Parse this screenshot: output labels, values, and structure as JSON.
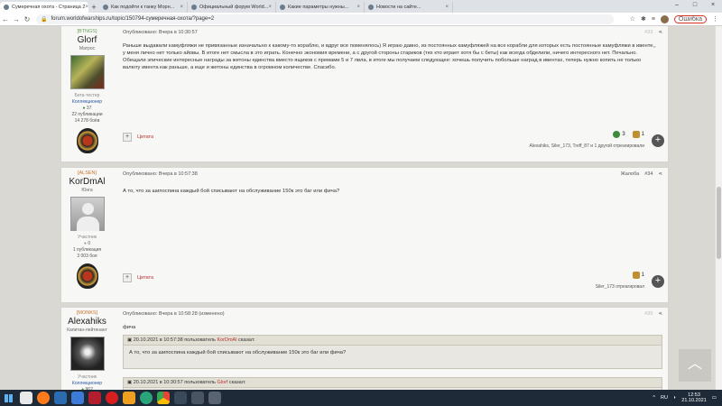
{
  "browser": {
    "tabs": [
      {
        "label": "Сумеречная охота - Страница 2",
        "active": true
      },
      {
        "label": "Как подойти к танку Морн...",
        "active": false
      },
      {
        "label": "Официальный форум World...",
        "active": false
      },
      {
        "label": "Какие параметры нужны...",
        "active": false
      },
      {
        "label": "Новости на сайте...",
        "active": false
      }
    ],
    "url": "forum.worldofwarships.ru/topic/150794-сумеречная-охота/?page=2",
    "error_label": "Ошибка"
  },
  "posts": [
    {
      "clan": "[BTNGS]",
      "username": "Glorf",
      "rank": "Матрос",
      "meta": [
        "Бета-тестер",
        "Коллекционер",
        "37",
        "22 публикации",
        "14 278 боёв"
      ],
      "published": "Опубликовано: Вчера в 10:30:57",
      "number": "#33",
      "text": "Раньше выдавали камуфляжи не привязанные изначально к какому-то кораблю, и вдруг все поменялось) Я играю давно, из постоянных камуфляжей на все корабли для которых есть постоянные камуфляжи в ивенте,, у меня лично нет только айовы. В итоге нет смысла в это играть. Конечно экономия времени, а с другой стороны стариков (тех кто играет хотя бы с беты) как всегда обделили, ничего интересного нет. Печально.\nОбещали эпические интересные награды за жетоны единства вместо ящиков с премами 5 и 7 лвла, в итоге мы получаем следующее: хочешь получить побольше наград в ивентах, теперь нужно копить не только валюту ивента как раньше, а еще и жетоны единства в огромном количестве. Спасибо.",
      "quote_label": "Цитата",
      "reactions": [
        {
          "icon": "plus-circle",
          "count": "3",
          "color": "#3c8c3c"
        },
        {
          "icon": "hat",
          "count": "1",
          "color": "#c09030"
        }
      ],
      "reacted": "Alexahiks, Siler_173, Treff_87 и 1 другой отреагировали"
    },
    {
      "clan": "[ALSEN]",
      "username": "KorDmAl",
      "rank": "Юнга",
      "meta": [
        "Участник",
        "0",
        "1 публикация",
        "3 003 боя"
      ],
      "published": "Опубликовано: Вчера в 10:57:38",
      "report": "Жалоба",
      "number": "#34",
      "text": "А то, что за шипоспина каждый бой списывают на обслуживание 150к это баг или фича?",
      "quote_label": "Цитата",
      "reactions": [
        {
          "icon": "hat",
          "count": "1",
          "color": "#c09030"
        }
      ],
      "reacted": "Siler_173 отреагировал"
    },
    {
      "clan": "[MONKS]",
      "username": "Alexahiks",
      "rank": "Капитан-лейтенант",
      "meta": [
        "Участник",
        "Коллекционер",
        "962"
      ],
      "published": "Опубликовано: Вчера в 10:58:28 (изменено)",
      "number": "#35",
      "text": "фича",
      "quotes": [
        {
          "date": "20.10.2021 в 10:57:38",
          "author_prefix": "пользователь",
          "author": "KorDmAl",
          "said": "сказал:",
          "text": "А то, что за шипоспина каждый бой списывают на обслуживание 150к это баг или фича?"
        },
        {
          "date": "20.10.2021 в 10:30:57",
          "author_prefix": "пользователь",
          "author": "Glorf",
          "said": "сказал:",
          "text": ""
        }
      ]
    }
  ],
  "taskbar": {
    "lang": "RU",
    "time": "12:53",
    "date": "21.10.2021"
  }
}
